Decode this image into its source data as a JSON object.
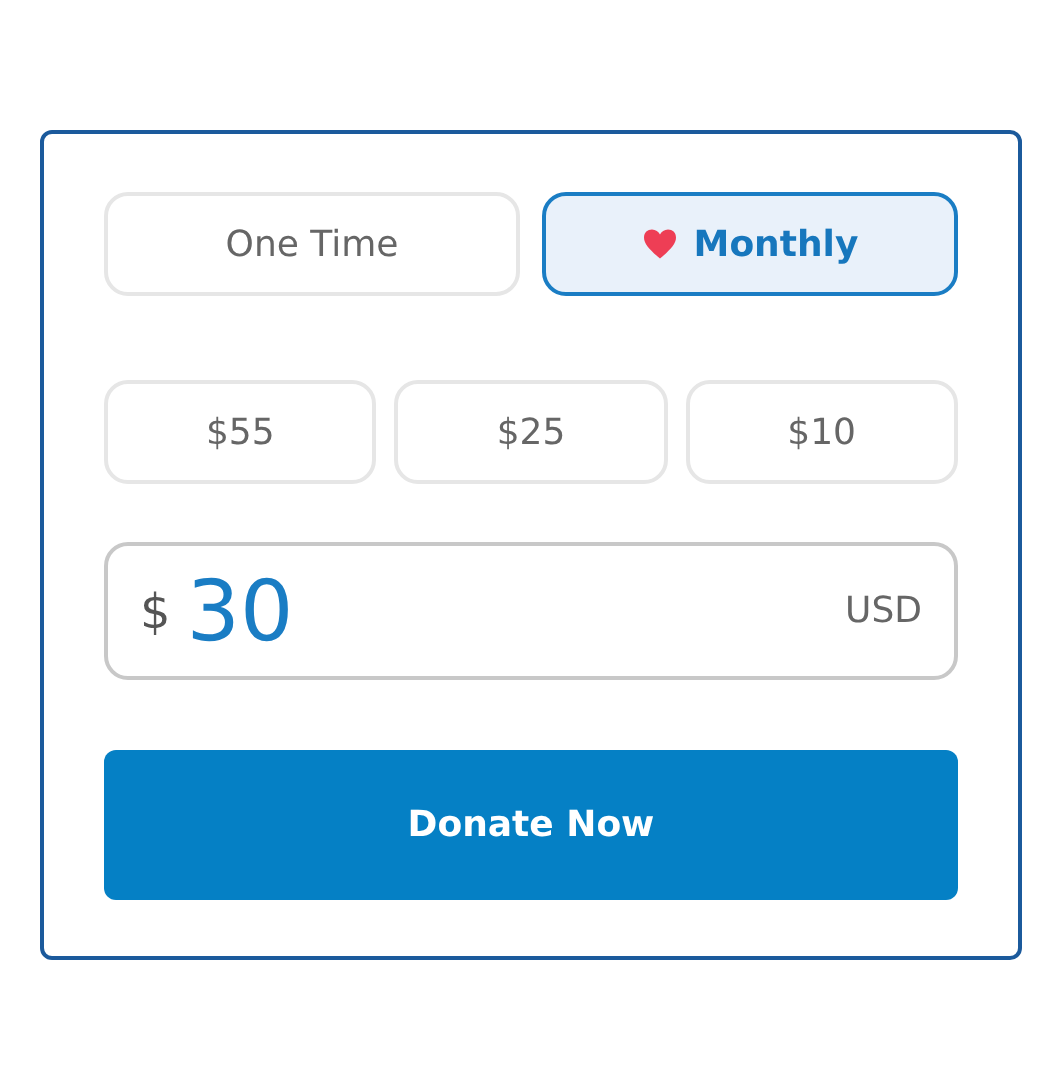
{
  "frequency": [
    {
      "label": "One Time",
      "kind": "single",
      "selected": false
    },
    {
      "label": "Monthly",
      "kind": "recurring",
      "selected": true
    }
  ],
  "amounts": [
    {
      "label": "$55",
      "selected": false
    },
    {
      "label": "$25",
      "selected": false
    },
    {
      "label": "$10",
      "selected": false
    }
  ],
  "amount_field": {
    "prefix": "$",
    "value": "30",
    "currency": "USD"
  },
  "submit_button": "Donate Now"
}
